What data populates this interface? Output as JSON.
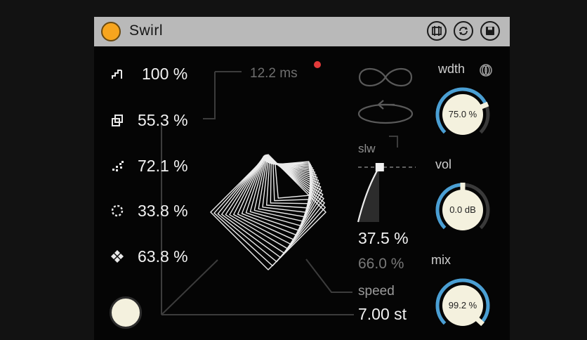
{
  "device": {
    "title": "Swirl",
    "accent": "#f7a51e",
    "knob_ring_color": "#4a9fd4"
  },
  "titlebar_icons": [
    "freeze-icon",
    "refresh-icon",
    "save-icon"
  ],
  "params": [
    {
      "icon": "stairs-icon",
      "value": "100 %"
    },
    {
      "icon": "copy-stack-icon",
      "value": "55.3 %"
    },
    {
      "icon": "scatter-dots-icon",
      "value": "72.1 %"
    },
    {
      "icon": "dotted-circle-icon",
      "value": "33.8 %"
    },
    {
      "icon": "checker-diamond-icon",
      "value": "63.8 %"
    }
  ],
  "time": {
    "value": "12.2 ms"
  },
  "mode": {
    "slow_label": "slw",
    "icons": [
      "infinity-loop-icon",
      "circular-arrow-icon"
    ]
  },
  "slider": {
    "value_primary": "37.5 %",
    "value_secondary": "66.0 %",
    "level": 0.375
  },
  "speed": {
    "label": "speed",
    "value": "7.00 st"
  },
  "knobs": {
    "width": {
      "label": "wdth",
      "value": "75.0 %",
      "level": 0.75,
      "icon": "link-rings-icon"
    },
    "vol": {
      "label": "vol",
      "value": "0.0 dB",
      "level": 0.5
    },
    "mix": {
      "label": "mix",
      "value": "99.2 %",
      "level": 0.992
    }
  }
}
